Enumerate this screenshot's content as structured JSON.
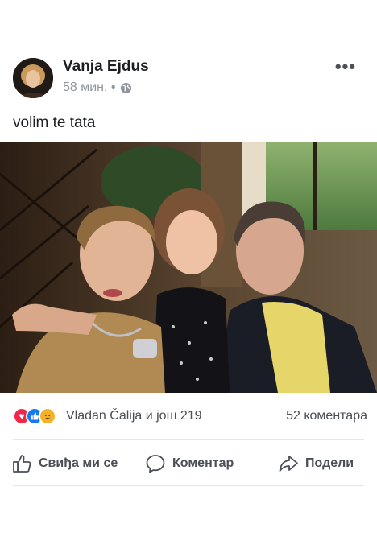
{
  "post": {
    "author": "Vanja Ejdus",
    "time": "58 мин. •",
    "privacy_icon": "globe-icon",
    "caption": "volim te tata"
  },
  "reactions": {
    "icons": [
      "love-icon",
      "like-icon",
      "sad-icon"
    ],
    "reactors_text": "Vladan Čalija и још 219",
    "comments_text": "52 коментара"
  },
  "actions": {
    "like_label": "Свиђа ми се",
    "comment_label": "Коментар",
    "share_label": "Подели"
  },
  "colors": {
    "like_blue": "#1877f2",
    "love_red": "#f0284a",
    "sad_yellow": "#f7b125",
    "secondary_text": "#90949c"
  }
}
